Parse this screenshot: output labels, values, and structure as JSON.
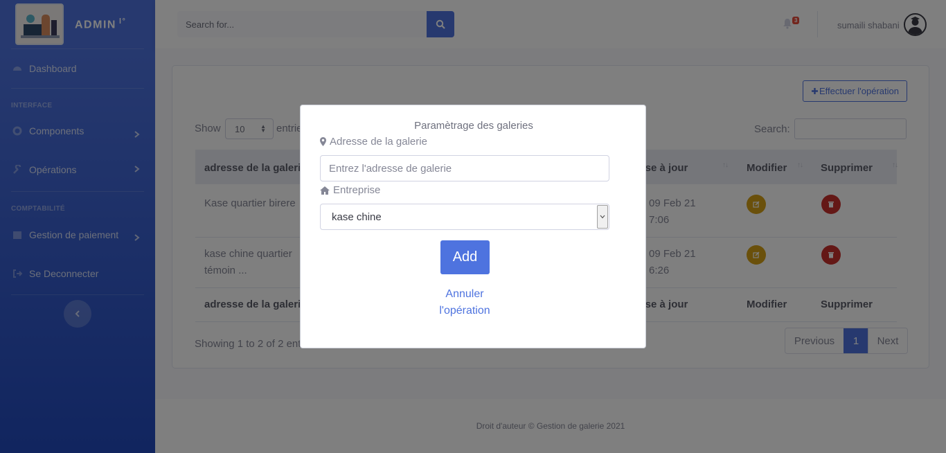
{
  "brand": {
    "title": "ADMIN",
    "superscript": "l°"
  },
  "sidebar": {
    "dashboard": "Dashboard",
    "heading_interface": "INTERFACE",
    "components": "Components",
    "operations": "Opérations",
    "heading_compta": "COMPTABILITÉ",
    "payment": "Gestion de paiement",
    "logout": "Se Deconnecter"
  },
  "topbar": {
    "search_placeholder": "Search for...",
    "notif_count": "3",
    "username": "sumaili shabani"
  },
  "page": {
    "action_button": "Effectuer l'opération",
    "show_label": "Show",
    "page_length": "10",
    "entries_label": "entries",
    "search_label": "Search:",
    "columns": [
      "adresse de la galerie",
      "Mise à jour",
      "Modifier",
      "Supprimer"
    ],
    "rows": [
      {
        "address_line1": "Kase quartier birere",
        "address_line2": "",
        "date_line1": "09 Feb 21",
        "date_line2": "7:06"
      },
      {
        "address_line1": "kase chine quartier",
        "address_line2": "témoin ...",
        "date_line1": "09 Feb 21",
        "date_line2": "6:26"
      }
    ],
    "showing": "Showing 1 to 2 of 2 entries",
    "pager": {
      "previous": "Previous",
      "current": "1",
      "next": "Next"
    }
  },
  "footer": "Droit d'auteur © Gestion de galerie 2021",
  "modal": {
    "title": "Paramètrage des galeries",
    "address_label": "Adresse de la galerie",
    "address_placeholder": "Entrez l'adresse de galerie",
    "company_label": "Entreprise",
    "company_value": "kase chine",
    "add_button": "Add",
    "cancel_line1": "Annuler",
    "cancel_line2": "l'opération"
  },
  "colors": {
    "primary": "#4e73df",
    "edit": "#d4a017",
    "delete": "#c9302c"
  }
}
